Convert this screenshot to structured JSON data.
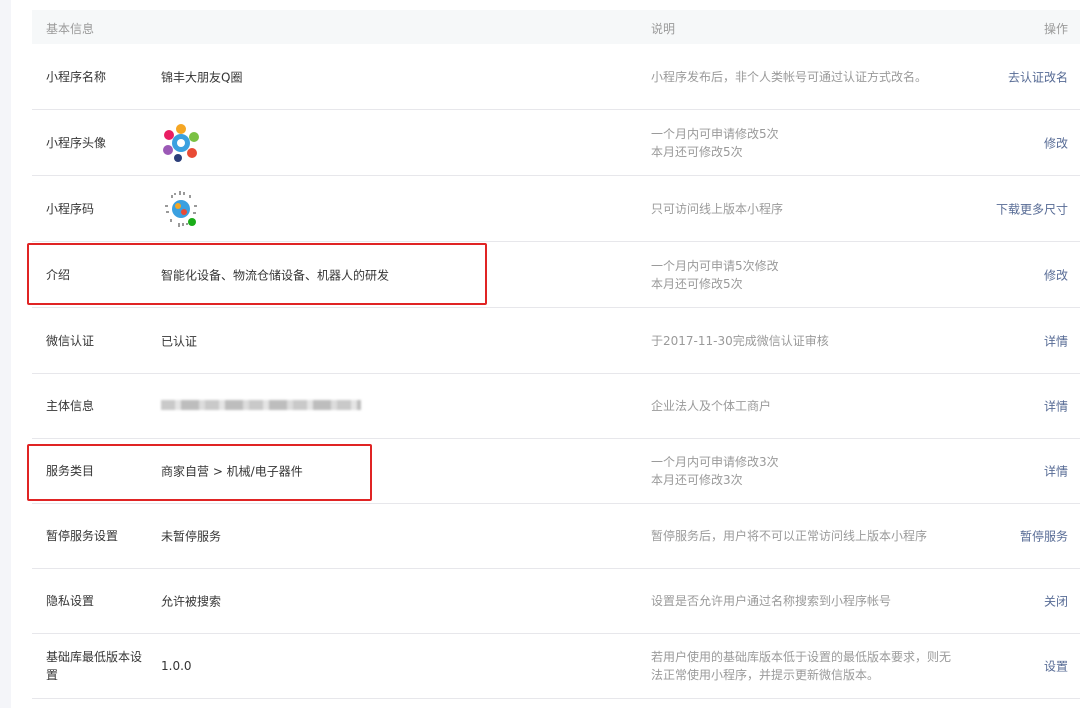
{
  "header": {
    "col1": "基本信息",
    "col3": "说明",
    "col4": "操作"
  },
  "rows": [
    {
      "label": "小程序名称",
      "value": "锦丰大朋友Q圈",
      "desc1": "小程序发布后，非个人类帐号可通过认证方式改名。",
      "desc2": "",
      "action": "去认证改名"
    },
    {
      "label": "小程序头像",
      "value": "",
      "desc1": "一个月内可申请修改5次",
      "desc2": "本月还可修改5次",
      "action": "修改"
    },
    {
      "label": "小程序码",
      "value": "",
      "desc1": "只可访问线上版本小程序",
      "desc2": "",
      "action": "下载更多尺寸"
    },
    {
      "label": "介绍",
      "value": "智能化设备、物流仓储设备、机器人的研发",
      "desc1": "一个月内可申请5次修改",
      "desc2": "本月还可修改5次",
      "action": "修改"
    },
    {
      "label": "微信认证",
      "value": "已认证",
      "desc1": "于2017-11-30完成微信认证审核",
      "desc2": "",
      "action": "详情"
    },
    {
      "label": "主体信息",
      "value": "",
      "desc1": "企业法人及个体工商户",
      "desc2": "",
      "action": "详情"
    },
    {
      "label": "服务类目",
      "value": "商家自营 > 机械/电子器件",
      "desc1": "一个月内可申请修改3次",
      "desc2": "本月还可修改3次",
      "action": "详情"
    },
    {
      "label": "暂停服务设置",
      "value": "未暂停服务",
      "desc1": "暂停服务后，用户将不可以正常访问线上版本小程序",
      "desc2": "",
      "action": "暂停服务"
    },
    {
      "label": "隐私设置",
      "value": "允许被搜索",
      "desc1": "设置是否允许用户通过名称搜索到小程序帐号",
      "desc2": "",
      "action": "关闭"
    },
    {
      "label": "基础库最低版本设置",
      "value": "1.0.0",
      "desc1": "若用户使用的基础库版本低于设置的最低版本要求，则无",
      "desc2": "法正常使用小程序，并提示更新微信版本。",
      "action": "设置"
    }
  ],
  "colors": {
    "link": "#576b95",
    "highlight": "#e02424",
    "muted": "#9a9a9a"
  }
}
